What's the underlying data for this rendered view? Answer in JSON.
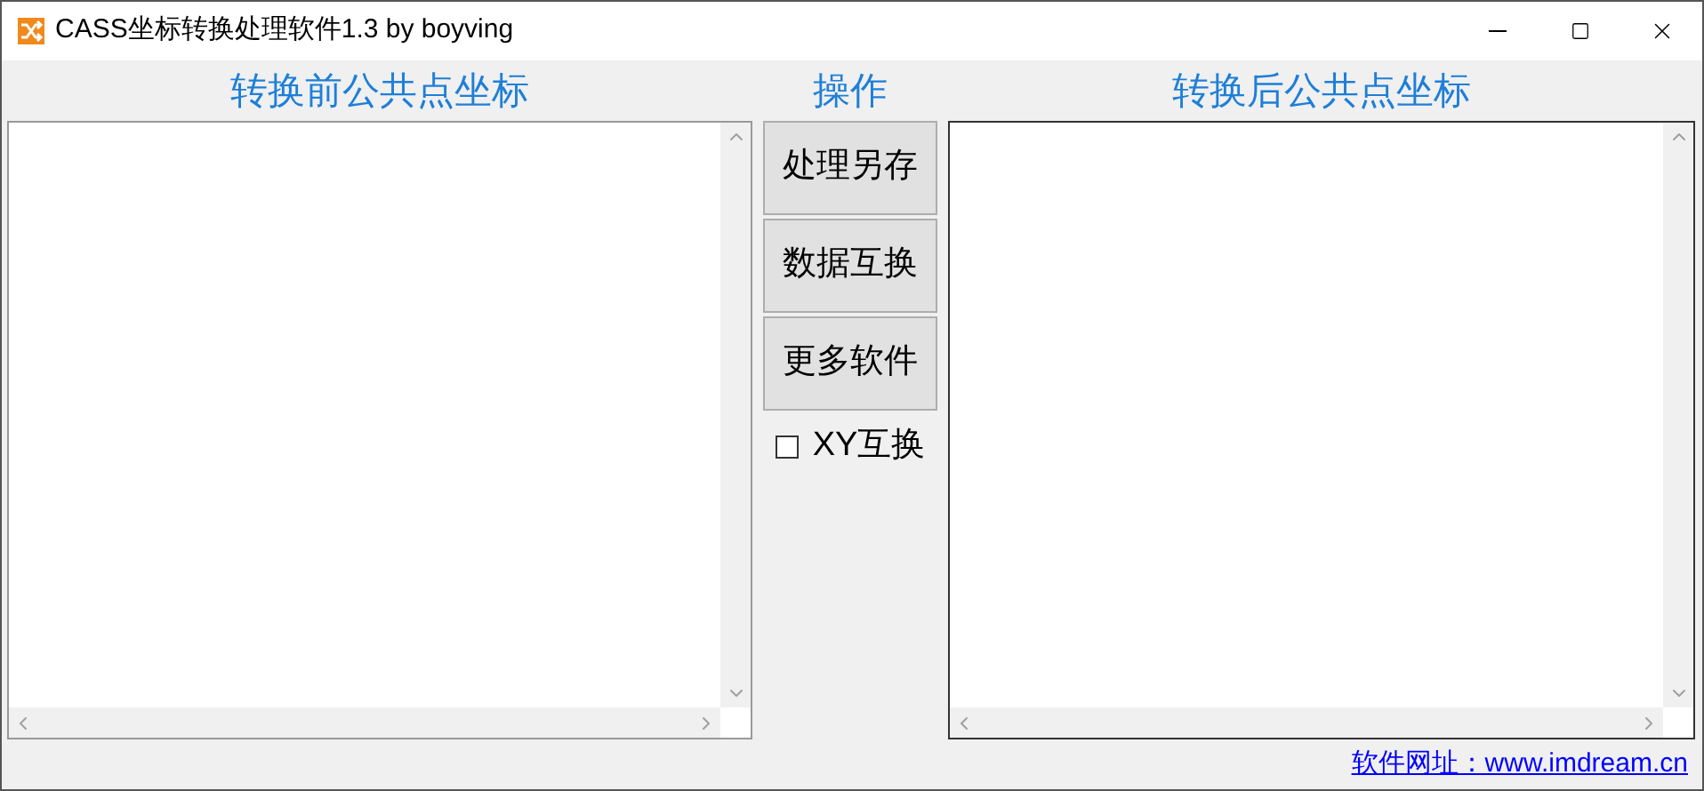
{
  "window": {
    "title": "CASS坐标转换处理软件1.3 by boyving"
  },
  "left_panel": {
    "heading": "转换前公共点坐标"
  },
  "operations": {
    "heading": "操作",
    "buttons": [
      "处理另存",
      "数据互换",
      "更多软件"
    ],
    "checkbox": {
      "label": "XY互换",
      "checked": false
    }
  },
  "right_panel": {
    "heading": "转换后公共点坐标"
  },
  "footer": {
    "link": "软件网址：www.imdream.cn"
  }
}
